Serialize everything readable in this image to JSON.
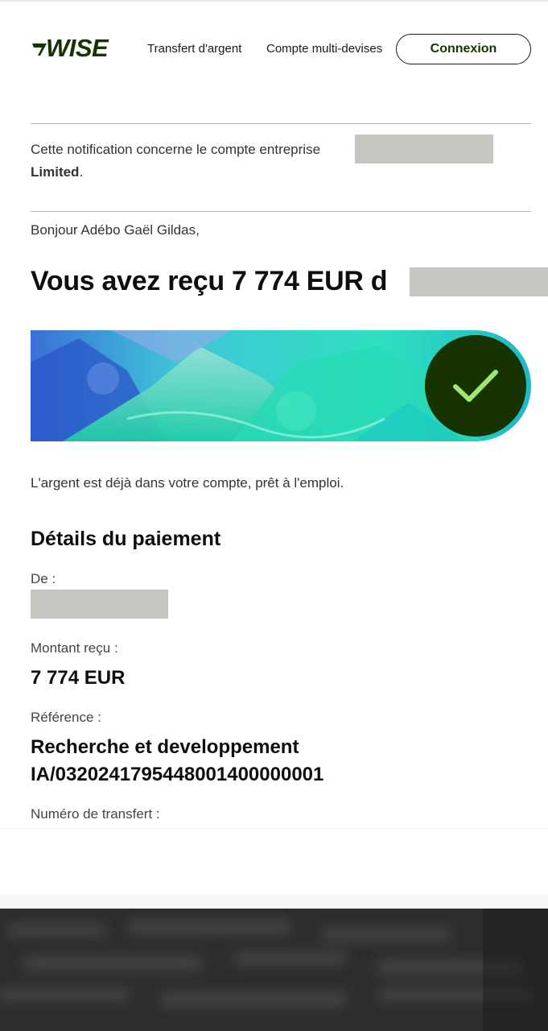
{
  "header": {
    "logo_text": "WISE",
    "nav": {
      "transfer": "Transfert d'argent",
      "multi_currency": "Compte multi-devises"
    },
    "login_label": "Connexion"
  },
  "notice": {
    "text": "Cette notification concerne le compte entreprise",
    "company_suffix": "Limited"
  },
  "greeting": "Bonjour Adébo Gaël Gildas,",
  "headline": "Vous avez reçu 7 774 EUR d",
  "money_note": "L'argent est déjà dans votre compte, prêt à l'emploi.",
  "details": {
    "title": "Détails du paiement",
    "from_label": "De :",
    "amount_label": "Montant reçu :",
    "amount_value": "7 774 EUR",
    "reference_label": "Référence :",
    "reference_line1": "Recherche et developpement",
    "reference_line2": "IA/0320241795448001400000001",
    "transfer_number_label": "Numéro de transfert :"
  },
  "colors": {
    "brand_dark_green": "#163300",
    "check_green": "#9fe870",
    "redaction": "#c7c6c1"
  }
}
